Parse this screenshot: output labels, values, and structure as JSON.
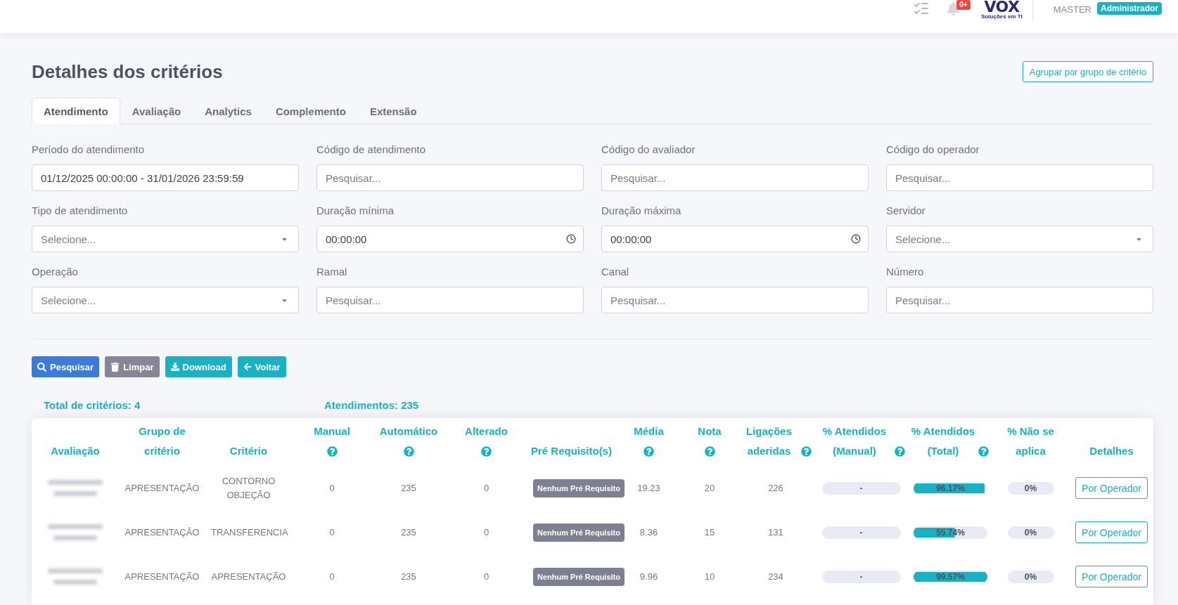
{
  "top_bar": {
    "notification_badge": "0+",
    "logo": {
      "name": "VOX",
      "tagline": "Soluções em TI"
    },
    "user_name": "MASTER",
    "role_badge": "Administrador"
  },
  "title": "Detalhes dos critérios",
  "group_button": "Agrupar por grupo de critério",
  "tabs": [
    {
      "label": "Atendimento",
      "selected": true
    },
    {
      "label": "Avaliação",
      "selected": false
    },
    {
      "label": "Analytics",
      "selected": false
    },
    {
      "label": "Complemento",
      "selected": false
    },
    {
      "label": "Extensão",
      "selected": false
    }
  ],
  "filters": [
    {
      "label": "Período do atendimento",
      "kind": "text",
      "value": "01/12/2025 00:00:00 - 31/01/2026 23:59:59"
    },
    {
      "label": "Código de atendimento",
      "kind": "text",
      "placeholder": "Pesquisar..."
    },
    {
      "label": "Código do avaliador",
      "kind": "text",
      "placeholder": "Pesquisar..."
    },
    {
      "label": "Código do operador",
      "kind": "text",
      "placeholder": "Pesquisar..."
    },
    {
      "label": "Tipo de atendimento",
      "kind": "select",
      "placeholder": "Selecione..."
    },
    {
      "label": "Duração mínima",
      "kind": "time",
      "value": "00:00:00"
    },
    {
      "label": "Duração máxima",
      "kind": "time",
      "value": "00:00:00"
    },
    {
      "label": "Servidor",
      "kind": "select",
      "placeholder": "Selecione..."
    },
    {
      "label": "Operação",
      "kind": "select",
      "placeholder": "Selecione..."
    },
    {
      "label": "Ramal",
      "kind": "text",
      "placeholder": "Pesquisar..."
    },
    {
      "label": "Canal",
      "kind": "text",
      "placeholder": "Pesquisar..."
    },
    {
      "label": "Número",
      "kind": "text",
      "placeholder": "Pesquisar..."
    }
  ],
  "actions": [
    {
      "label": "Pesquisar",
      "kind": "search"
    },
    {
      "label": "Limpar",
      "kind": "clear"
    },
    {
      "label": "Download",
      "kind": "download"
    },
    {
      "label": "Voltar",
      "kind": "back"
    }
  ],
  "summary": {
    "total_criteria": "Total de critérios: 4",
    "calls": "Atendimentos: 235"
  },
  "table": {
    "columns": [
      {
        "label": "Avaliação",
        "kind": "plain"
      },
      {
        "label": "Grupo de critério",
        "kind": "plain"
      },
      {
        "label": "Critério",
        "kind": "plain"
      },
      {
        "label": "Manual",
        "kind": "stacked"
      },
      {
        "label": "Automático",
        "kind": "stacked"
      },
      {
        "label": "Alterado",
        "kind": "stacked"
      },
      {
        "label": "Pré Requisito(s)",
        "kind": "plain"
      },
      {
        "label": "Média",
        "kind": "stacked"
      },
      {
        "label": "Nota",
        "kind": "stacked"
      },
      {
        "label": "Ligações aderidas",
        "kind": "inline"
      },
      {
        "label": "% Atendidos (Manual)",
        "kind": "inline"
      },
      {
        "label": "% Atendidos (Total)",
        "kind": "inline"
      },
      {
        "label": "% Não se aplica",
        "kind": "plain"
      },
      {
        "label": "Detalhes",
        "kind": "plain"
      }
    ],
    "rows": [
      {
        "group": "APRESENTAÇÃO",
        "criterion": "CONTORNO OBJEÇÃO",
        "manual": "0",
        "automatic": "235",
        "changed": "0",
        "prerequisite": "Nenhum Pré Requisito",
        "average": "19.23",
        "score": "20",
        "adhered_calls": "226",
        "pct_manual": {
          "text": "-"
        },
        "pct_total": {
          "text": "96.17%",
          "level": 0.9617
        },
        "pct_not_applicable": {
          "text": "0%"
        },
        "details_button": "Por Operador"
      },
      {
        "group": "APRESENTAÇÃO",
        "criterion": "TRANSFERENCIA",
        "manual": "0",
        "automatic": "235",
        "changed": "0",
        "prerequisite": "Nenhum Pré Requisito",
        "average": "8.36",
        "score": "15",
        "adhered_calls": "131",
        "pct_manual": {
          "text": "-"
        },
        "pct_total": {
          "text": "55.74%",
          "level": 0.5574
        },
        "pct_not_applicable": {
          "text": "0%"
        },
        "details_button": "Por Operador"
      },
      {
        "group": "APRESENTAÇÃO",
        "criterion": "APRESENTAÇÃO",
        "manual": "0",
        "automatic": "235",
        "changed": "0",
        "prerequisite": "Nenhum Pré Requisito",
        "average": "9.96",
        "score": "10",
        "adhered_calls": "234",
        "pct_manual": {
          "text": "-"
        },
        "pct_total": {
          "text": "99.57%",
          "level": 0.9957
        },
        "pct_not_applicable": {
          "text": "0%"
        },
        "details_button": "Por Operador"
      }
    ]
  }
}
